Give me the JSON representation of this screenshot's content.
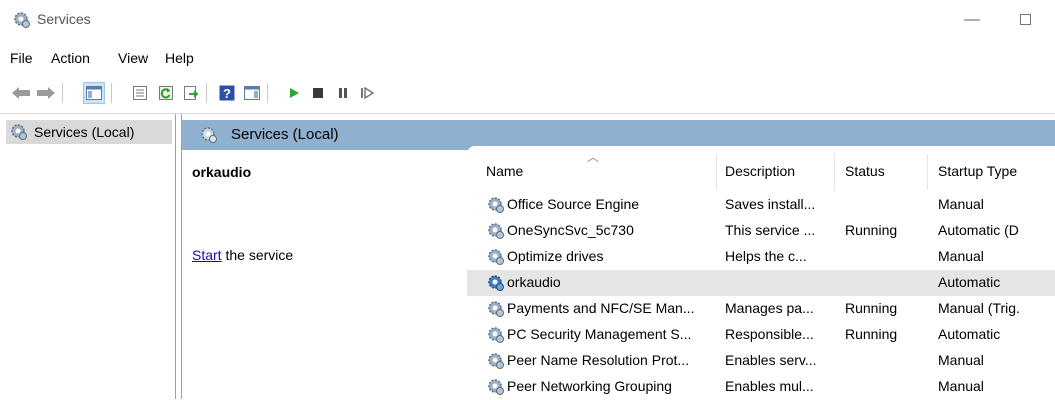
{
  "window": {
    "title": "Services",
    "minimize_glyph": "—"
  },
  "menu": [
    "File",
    "Action",
    "View",
    "Help"
  ],
  "toolbar": {
    "icons": [
      "back-arrow-icon",
      "forward-arrow-icon",
      "show-hide-tree-icon",
      "properties-icon",
      "refresh-icon",
      "export-list-icon",
      "help-icon",
      "show-hide-action-pane-icon",
      "start-service-icon",
      "stop-service-icon",
      "pause-service-icon",
      "resume-service-icon"
    ]
  },
  "tree": {
    "root_label": "Services (Local)"
  },
  "panel": {
    "header_label": "Services (Local)",
    "selected_service": "orkaudio",
    "action_link": "Start",
    "action_rest": " the service"
  },
  "columns": {
    "name": "Name",
    "description": "Description",
    "status": "Status",
    "startup": "Startup Type"
  },
  "services": [
    {
      "name": "Office  Source Engine",
      "description": "Saves install...",
      "status": "",
      "startup": "Manual"
    },
    {
      "name": "OneSyncSvc_5c730",
      "description": "This service ...",
      "status": "Running",
      "startup": "Automatic (D"
    },
    {
      "name": "Optimize drives",
      "description": "Helps the c...",
      "status": "",
      "startup": "Manual"
    },
    {
      "name": "orkaudio",
      "description": "",
      "status": "",
      "startup": "Automatic"
    },
    {
      "name": "Payments and NFC/SE Man...",
      "description": "Manages pa...",
      "status": "Running",
      "startup": "Manual (Trig."
    },
    {
      "name": "PC Security Management S...",
      "description": "Responsible...",
      "status": "Running",
      "startup": "Automatic"
    },
    {
      "name": "Peer Name Resolution Prot...",
      "description": "Enables serv...",
      "status": "",
      "startup": "Manual"
    },
    {
      "name": "Peer Networking Grouping",
      "description": "Enables mul...",
      "status": "",
      "startup": "Manual"
    }
  ],
  "colors": {
    "panel_header": "#8fb0cf",
    "selected_row": "#e5e5e5",
    "link": "#1a0dab"
  }
}
